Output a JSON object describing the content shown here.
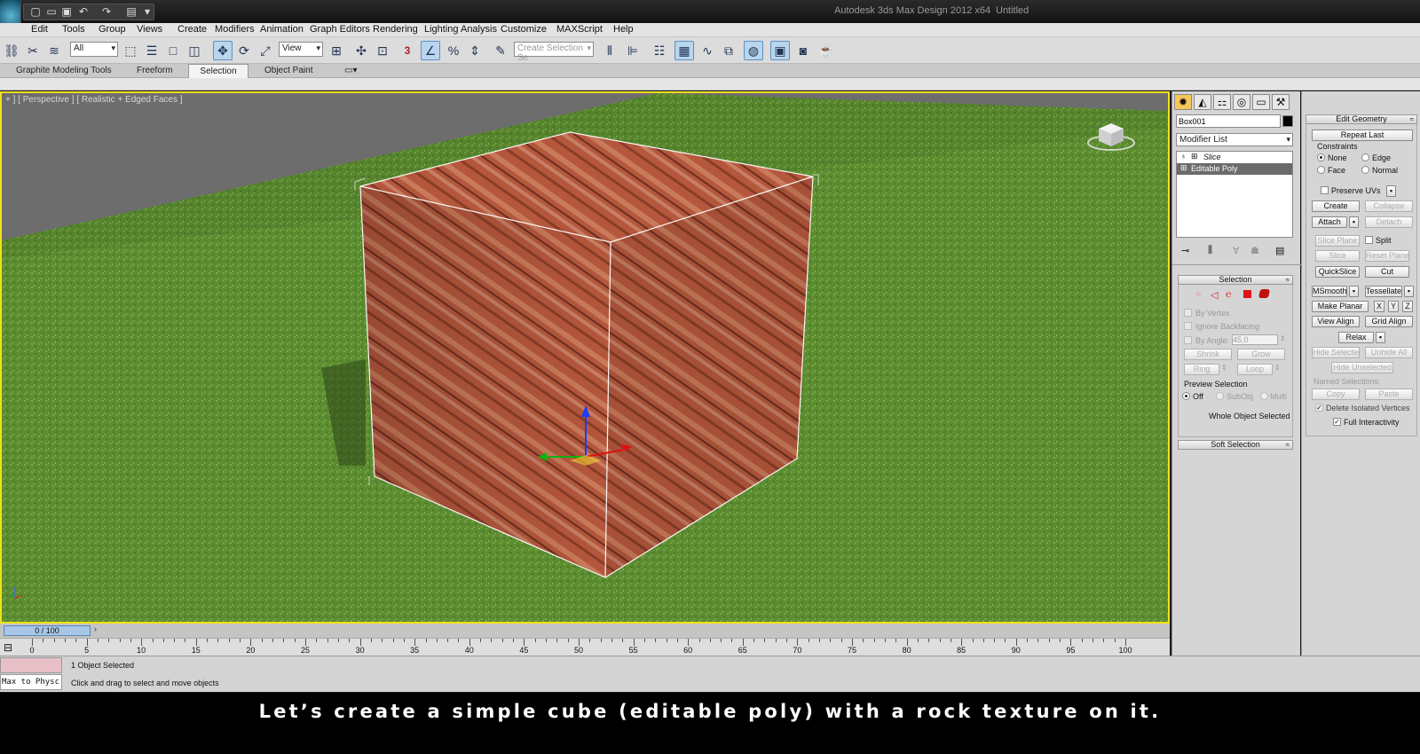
{
  "app": {
    "title": "Autodesk 3ds Max Design 2012 x64",
    "document": "Untitled"
  },
  "menu": [
    "Edit",
    "Tools",
    "Group",
    "Views",
    "Create",
    "Modifiers",
    "Animation",
    "Graph Editors",
    "Rendering",
    "Lighting Analysis",
    "Customize",
    "MAXScript",
    "Help"
  ],
  "toolbar": {
    "selection_filter": "All",
    "reference_coord": "View",
    "named_selection_placeholder": "Create Selection Se",
    "snap_label": "3"
  },
  "ribbon": {
    "tabs": [
      "Graphite Modeling Tools",
      "Freeform",
      "Selection",
      "Object Paint"
    ],
    "active_tab": "Selection"
  },
  "viewport": {
    "label": "+ ] [ Perspective ] [ Realistic + Edged Faces ]"
  },
  "command_panel": {
    "object_name": "Box001",
    "modifier_list_label": "Modifier List",
    "modifier_stack": [
      "Slice",
      "Editable Poly"
    ],
    "selection_rollout": {
      "title": "Selection",
      "by_vertex": "By Vertex",
      "ignore_backfacing": "Ignore Backfacing",
      "by_angle": "By Angle:",
      "angle_value": "45,0",
      "shrink": "Shrink",
      "grow": "Grow",
      "ring": "Ring",
      "loop": "Loop",
      "preview_selection": "Preview Selection",
      "preview_options": [
        "Off",
        "SubObj",
        "Multi"
      ],
      "status": "Whole Object Selected"
    },
    "soft_selection_title": "Soft Selection",
    "edit_geometry": {
      "title": "Edit Geometry",
      "repeat_last": "Repeat Last",
      "constraints_label": "Constraints",
      "constraints": [
        "None",
        "Edge",
        "Face",
        "Normal"
      ],
      "preserve_uvs": "Preserve UVs",
      "create": "Create",
      "collapse": "Collapse",
      "attach": "Attach",
      "detach": "Detach",
      "slice_plane": "Slice Plane",
      "split": "Split",
      "slice": "Slice",
      "reset_plane": "Reset Plane",
      "quickslice": "QuickSlice",
      "cut": "Cut",
      "msmooth": "MSmooth",
      "tessellate": "Tessellate",
      "make_planar": "Make Planar",
      "x": "X",
      "y": "Y",
      "z": "Z",
      "view_align": "View Align",
      "grid_align": "Grid Align",
      "relax": "Relax",
      "hide_selected": "Hide Selected",
      "unhide_all": "Unhide All",
      "hide_unselected": "Hide Unselected",
      "named_selections": "Named Selections:",
      "copy": "Copy",
      "paste": "Paste",
      "delete_isolated": "Delete Isolated Vertices",
      "full_interactivity": "Full Interactivity"
    }
  },
  "timeline": {
    "slider_label": "0 / 100",
    "ticks": [
      0,
      5,
      10,
      15,
      20,
      25,
      30,
      35,
      40,
      45,
      50,
      55,
      60,
      65,
      70,
      75,
      80,
      85,
      90,
      95,
      100
    ],
    "max": 100
  },
  "status": {
    "maxscript_text": "Max to Physc",
    "line1": "1 Object Selected",
    "line2": "Click and drag to select and move objects"
  },
  "caption": "Let’s create a simple cube (editable poly) with a rock texture on it.",
  "colors": {
    "viewport_border": "#f1e11d",
    "grass": "#5e8f33",
    "rock": "#b5553a",
    "active_tab": "#f6c55b"
  }
}
